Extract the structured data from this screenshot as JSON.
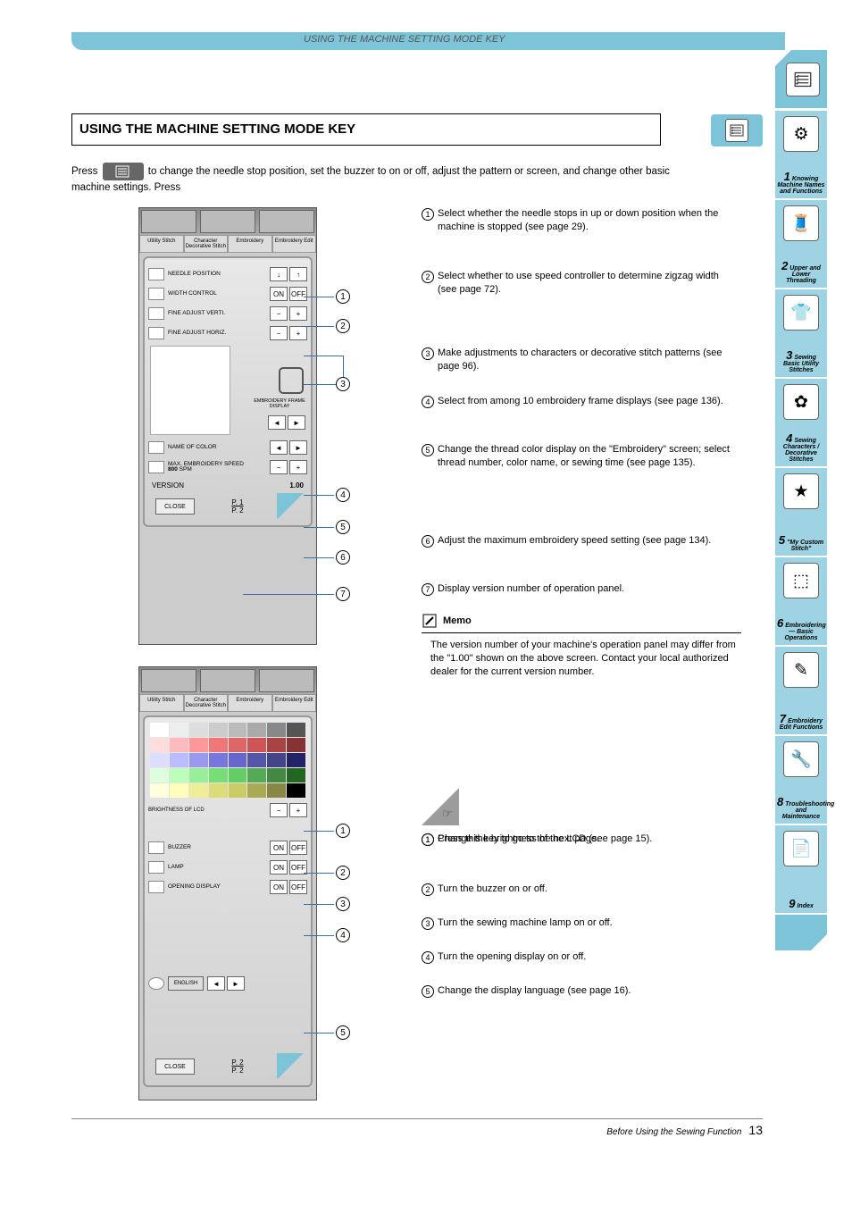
{
  "header": {
    "breadcrumb": "USING THE MACHINE SETTING MODE KEY"
  },
  "section_title": "USING THE MACHINE SETTING MODE KEY",
  "intro": "to change the needle stop position, set the buzzer to on or off, adjust the pattern or screen, and change other basic machine settings. Press",
  "screen1": {
    "tabs": [
      "Utility Stitch",
      "Character Decorative Stitch",
      "Embroidery",
      "Embroidery Edit"
    ],
    "rows": {
      "needle_pos": "NEEDLE POSITION",
      "width_ctrl": "WIDTH CONTROL",
      "on": "ON",
      "off": "OFF",
      "fine_v": "FINE ADJUST VERTI.",
      "fine_h": "FINE ADJUST HORIZ.",
      "frame": "EMBROIDERY FRAME DISPLAY",
      "name_color": "NAME OF COLOR",
      "max_speed": "MAX. EMBROIDERY SPEED",
      "speed_val": "800",
      "spm": "SPM"
    },
    "version_label": "VERSION",
    "version_value": "1.00",
    "close": "CLOSE",
    "page": "P. 1",
    "page_of": "P. 2"
  },
  "screen2": {
    "tabs": [
      "Utility Stitch",
      "Character Decorative Stitch",
      "Embroidery",
      "Embroidery Edit"
    ],
    "brightness": "BRIGHTNESS OF LCD",
    "buzzer": "BUZZER",
    "lamp": "LAMP",
    "opening": "OPENING DISPLAY",
    "language": "ENGLISH",
    "close": "CLOSE",
    "on": "ON",
    "off": "OFF",
    "page": "P. 2",
    "page_of": "P. 2"
  },
  "desc1": [
    "Select whether the needle stops in up or down position when the machine is stopped (see page 29).",
    "Select whether to use speed controller to determine zigzag width (see page 72).",
    "Make adjustments to characters or decorative stitch patterns (see page 96).",
    "Select from among 10 embroidery frame displays (see page 136).",
    "Change the thread color display on the \"Embroidery\" screen; select thread number, color name, or sewing time (see page 135).",
    "Adjust the maximum embroidery speed setting (see page 134).",
    "Display version number of operation panel."
  ],
  "memo": {
    "title": "Memo",
    "body": "The version number of your machine's operation panel may differ from the \"1.00\" shown on the above screen. Contact your local authorized dealer for the current version number."
  },
  "page_note": "Press this key to go to the next page.",
  "desc2": [
    "Change the brightness of the LCD (see page 15).",
    "Turn the buzzer on or off.",
    "Turn the sewing machine lamp on or off.",
    "Turn the opening display on or off.",
    "Change the display language (see page 16)."
  ],
  "sidebar": {
    "chapters": [
      {
        "num": "1",
        "label": "Knowing Machine Names and Functions"
      },
      {
        "num": "2",
        "label": "Upper and Lower Threading"
      },
      {
        "num": "3",
        "label": "Sewing Basic Utility Stitches"
      },
      {
        "num": "4",
        "label": "Sewing Characters / Decorative Stitches"
      },
      {
        "num": "5",
        "label": "\"My Custom Stitch\""
      },
      {
        "num": "6",
        "label": "Embroidering — Basic Operations"
      },
      {
        "num": "7",
        "label": "Embroidery Edit Functions"
      },
      {
        "num": "8",
        "label": "Troubleshooting and Maintenance"
      },
      {
        "num": "9",
        "label": "Index"
      }
    ]
  },
  "footer": {
    "text": "Before Using the Sewing Function",
    "page": "13"
  }
}
